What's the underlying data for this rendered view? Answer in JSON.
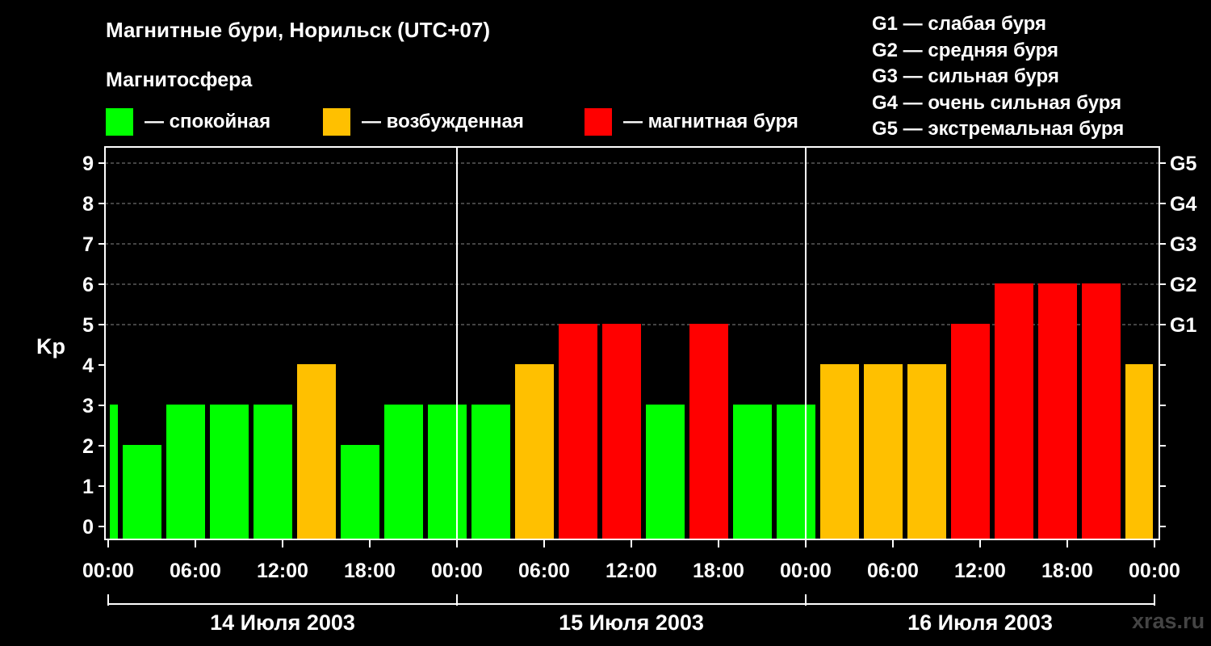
{
  "header": {
    "title": "Магнитные бури, Норильск (UTC+07)",
    "subtitle": "Магнитосфера"
  },
  "legend": {
    "items": [
      {
        "label": "— спокойная",
        "color": "#00ff00"
      },
      {
        "label": "— возбужденная",
        "color": "#ffc000"
      },
      {
        "label": "— магнитная буря",
        "color": "#ff0000"
      }
    ]
  },
  "g_legend": [
    "G1 — слабая буря",
    "G2 — средняя буря",
    "G3 — сильная буря",
    "G4 — очень сильная буря",
    "G5 — экстремальная буря"
  ],
  "watermark": "xras.ru",
  "colors": {
    "quiet": "#00ff00",
    "active": "#ffc000",
    "storm": "#ff0000",
    "background": "#000000"
  },
  "chart_data": {
    "type": "bar",
    "title": "Магнитные бури, Норильск (UTC+07)",
    "ylabel": "Kp",
    "ylim": [
      0,
      9
    ],
    "yticks": [
      "0",
      "1",
      "2",
      "3",
      "4",
      "5",
      "6",
      "7",
      "8",
      "9"
    ],
    "right_axis": [
      {
        "value": 5,
        "label": "G1"
      },
      {
        "value": 6,
        "label": "G2"
      },
      {
        "value": 7,
        "label": "G3"
      },
      {
        "value": 8,
        "label": "G4"
      },
      {
        "value": 9,
        "label": "G5"
      }
    ],
    "xticks": [
      "00:00",
      "06:00",
      "12:00",
      "18:00",
      "00:00",
      "06:00",
      "12:00",
      "18:00",
      "00:00",
      "06:00",
      "12:00",
      "18:00",
      "00:00"
    ],
    "days": [
      "14 Июля 2003",
      "15 Июля 2003",
      "16 Июля 2003"
    ],
    "interval_hours": 3,
    "x_start_hour": 0,
    "x_end_hour": 72,
    "bar_start_hours": [
      -2,
      1,
      4,
      7,
      10,
      13,
      16,
      19,
      22,
      25,
      28,
      31,
      34,
      37,
      40,
      43,
      46,
      49,
      52,
      55,
      58,
      61,
      64,
      67,
      70
    ],
    "values": [
      3,
      2,
      3,
      3,
      3,
      4,
      2,
      3,
      3,
      3,
      4,
      5,
      5,
      3,
      5,
      3,
      3,
      4,
      4,
      4,
      5,
      6,
      6,
      6,
      4
    ],
    "status": [
      "quiet",
      "quiet",
      "quiet",
      "quiet",
      "quiet",
      "active",
      "quiet",
      "quiet",
      "quiet",
      "quiet",
      "active",
      "storm",
      "storm",
      "quiet",
      "storm",
      "quiet",
      "quiet",
      "active",
      "active",
      "active",
      "storm",
      "storm",
      "storm",
      "storm",
      "active"
    ],
    "grid": "dashed at Kp 5–9",
    "legend_position": "top"
  }
}
